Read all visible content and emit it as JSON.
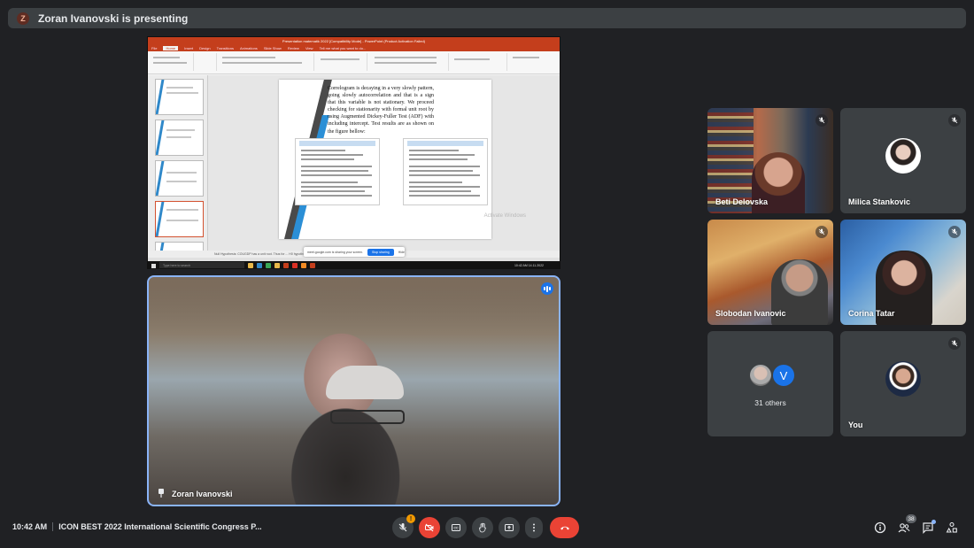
{
  "presenting_bar": {
    "avatar_letter": "Z",
    "text": "Zoran Ivanovski is presenting"
  },
  "shared_screen": {
    "window_title": "Presentation matematik 2022 [Compatibility Mode] - PowerPoint (Product Activation Failed)",
    "ribbon_tabs": [
      "File",
      "Home",
      "Insert",
      "Design",
      "Transitions",
      "Animations",
      "Slide Show",
      "Review",
      "View",
      "Tell me what you want to do..."
    ],
    "active_tab": "Home",
    "slide_text": "Correlogram is decaying in a very slowly pattern, going slowly autocorrelation and that is a sign that this variable is not stationary. We proceed checking for stationarity with formal unit root by using Augmented Dickey-Fuller Test (ADF) with including intercept. Test results are as shown on the figure bellow:",
    "watermark": "Activate Windows",
    "notes_text": "Null Hypothesis: COUGDP has a unit root. Thus for ... H0 hypothesis can not be rejected. We can conclude that series has unit root and is",
    "share_notice": "meet.google.com is sharing your screen.",
    "stop_sharing": "Stop sharing",
    "hide": "Hide",
    "taskbar_search": "Type here to search",
    "taskbar_time": "10:42 AM",
    "taskbar_date": "14.11.2022"
  },
  "presenter_tile": {
    "name": "Zoran Ivanovski"
  },
  "participants": [
    {
      "name": "Beti Delovska",
      "muted": true
    },
    {
      "name": "Milica Stankovic",
      "muted": true
    },
    {
      "name": "Slobodan Ivanovic",
      "muted": true
    },
    {
      "name": "Corina Tatar",
      "muted": true
    },
    {
      "name": "31 others",
      "avatar_letter": "V"
    },
    {
      "name": "You",
      "muted": true
    }
  ],
  "bottom_bar": {
    "time": "10:42 AM",
    "meeting_title": "ICON BEST 2022 International Scientific Congress P...",
    "mic_badge": "!",
    "people_count": "38"
  },
  "colors": {
    "background": "#202124",
    "tile": "#3c4043",
    "accent": "#8ab4f8",
    "end_call": "#ea4335",
    "ppt_orange": "#c43e1c"
  }
}
